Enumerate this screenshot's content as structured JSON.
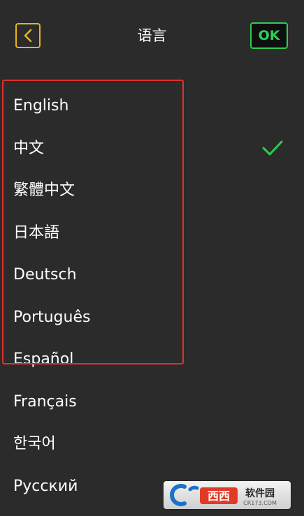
{
  "header": {
    "title": "语言",
    "ok_label": "OK",
    "back_icon": "chevron-left-icon"
  },
  "languages": [
    {
      "label": "English",
      "selected": false
    },
    {
      "label": "中文",
      "selected": true
    },
    {
      "label": "繁體中文",
      "selected": false
    },
    {
      "label": "日本語",
      "selected": false
    },
    {
      "label": "Deutsch",
      "selected": false
    },
    {
      "label": "Português",
      "selected": false
    },
    {
      "label": "Español",
      "selected": false
    },
    {
      "label": "Français",
      "selected": false
    },
    {
      "label": "한국어",
      "selected": false
    },
    {
      "label": "Русский",
      "selected": false
    }
  ],
  "colors": {
    "background": "#2b2b2b",
    "back_accent": "#e8b222",
    "ok_accent": "#2ecc52",
    "check": "#2ecc52",
    "highlight": "#e0312c"
  },
  "watermark": {
    "brand_text": "西西软件园",
    "site_text": "CR173.COM"
  }
}
